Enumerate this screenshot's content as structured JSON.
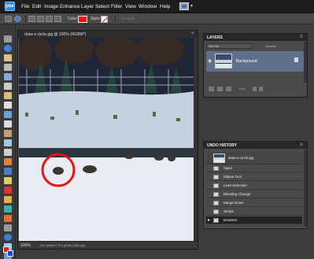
{
  "app": {
    "logo_text": "pse",
    "menu": [
      "File",
      "Edit",
      "Image",
      "Enhance",
      "Layer",
      "Select",
      "Filter",
      "View",
      "Window",
      "Help"
    ]
  },
  "options_bar": {
    "color_label": "Color:",
    "color_value": "#ff1010",
    "style_label": "Style:",
    "simplify_label": "Simplify"
  },
  "document": {
    "title": "draw a circle.jpg @ 100% (RGB/8*)",
    "close_glyph": "×",
    "zoom": "100%",
    "info": "497 pixels x 370 pixels (180 ppi)"
  },
  "layers_panel": {
    "title": "LAYERS",
    "blend_mode": "Normal",
    "opacity_label": "Opacity:",
    "layers": [
      {
        "name": "Background",
        "visible": true,
        "locked": true
      }
    ],
    "lock_label": "Lock:"
  },
  "history_panel": {
    "title": "UNDO HISTORY",
    "snapshot": "draw a circle.jpg",
    "steps": [
      "Open",
      "Ellipse Tool",
      "Load Selection",
      "Blending Change",
      "Merge Down",
      "Stroke",
      "Deselect"
    ],
    "active_step": "Deselect"
  },
  "colors": {
    "foreground": "#ff1010",
    "background": "#2040ff",
    "annotation_circle": "#ee1111"
  }
}
